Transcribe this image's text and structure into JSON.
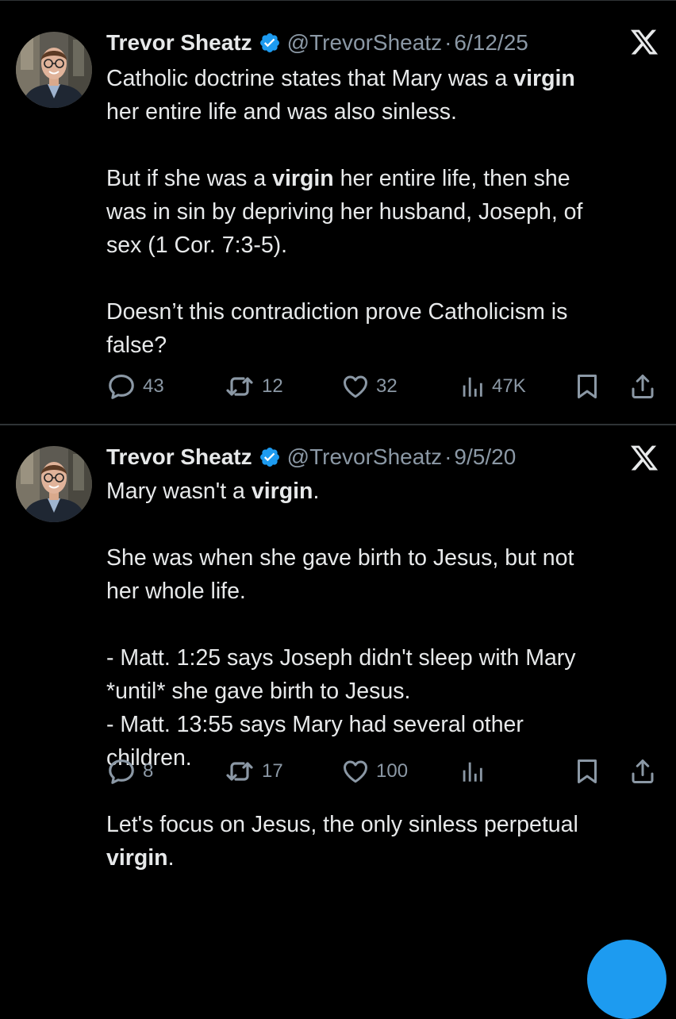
{
  "colors": {
    "background": "#000000",
    "text": "#e7e9ea",
    "secondary": "#8b98a5",
    "verified": "#1d9bf0",
    "divider": "#2f3336"
  },
  "tweets": [
    {
      "author": {
        "name": "Trevor Sheatz",
        "handle": "@TrevorSheatz",
        "verified_icon": "verified-badge-icon",
        "avatar_icon": "avatar-photo"
      },
      "separator": "·",
      "date": "6/12/25",
      "platform_icon": "x-logo-icon",
      "body": [
        [
          [
            {
              "t": "Catholic doctrine states that Mary was a "
            },
            {
              "t": "virgin",
              "b": true
            }
          ],
          [
            {
              "t": "her entire life and was also sinless."
            }
          ]
        ],
        [
          [
            {
              "t": "But if she was a "
            },
            {
              "t": "virgin",
              "b": true
            },
            {
              "t": " her entire life, then she"
            }
          ],
          [
            {
              "t": "was in sin by depriving her husband, Joseph, of"
            }
          ],
          [
            {
              "t": "sex (1 Cor. 7:3-5)."
            }
          ]
        ],
        [
          [
            {
              "t": "Doesn’t this contradiction prove Catholicism is"
            }
          ],
          [
            {
              "t": "false?"
            }
          ]
        ]
      ],
      "actions": {
        "reply": {
          "icon": "reply-icon",
          "count": "43"
        },
        "repost": {
          "icon": "repost-icon",
          "count": "12"
        },
        "like": {
          "icon": "heart-icon",
          "count": "32"
        },
        "views": {
          "icon": "views-icon",
          "count": "47K"
        },
        "bookmark": {
          "icon": "bookmark-icon"
        },
        "share": {
          "icon": "share-icon"
        }
      }
    },
    {
      "author": {
        "name": "Trevor Sheatz",
        "handle": "@TrevorSheatz",
        "verified_icon": "verified-badge-icon",
        "avatar_icon": "avatar-photo"
      },
      "separator": "·",
      "date": "9/5/20",
      "platform_icon": "x-logo-icon",
      "body": [
        [
          [
            {
              "t": "Mary wasn't a "
            },
            {
              "t": "virgin",
              "b": true
            },
            {
              "t": "."
            }
          ]
        ],
        [
          [
            {
              "t": "She was when she gave birth to Jesus, but not"
            }
          ],
          [
            {
              "t": "her whole life."
            }
          ]
        ],
        [
          [
            {
              "t": "- Matt. 1:25 says Joseph didn't sleep with Mary"
            }
          ],
          [
            {
              "t": "*until* she gave birth to Jesus."
            }
          ],
          [
            {
              "t": "- Matt. 13:55 says Mary had several other"
            }
          ],
          [
            {
              "t": "children."
            }
          ]
        ],
        [
          [
            {
              "t": "Let's focus on Jesus, the only sinless perpetual"
            }
          ],
          [
            {
              "t": "virgin",
              "b": true
            },
            {
              "t": "."
            }
          ]
        ]
      ],
      "actions": {
        "reply": {
          "icon": "reply-icon",
          "count": "8"
        },
        "repost": {
          "icon": "repost-icon",
          "count": "17"
        },
        "like": {
          "icon": "heart-icon",
          "count": "100"
        },
        "views": {
          "icon": "views-icon",
          "count": ""
        },
        "bookmark": {
          "icon": "bookmark-icon"
        },
        "share": {
          "icon": "share-icon"
        }
      }
    }
  ],
  "floating_button": {
    "icon": "compose-button"
  }
}
